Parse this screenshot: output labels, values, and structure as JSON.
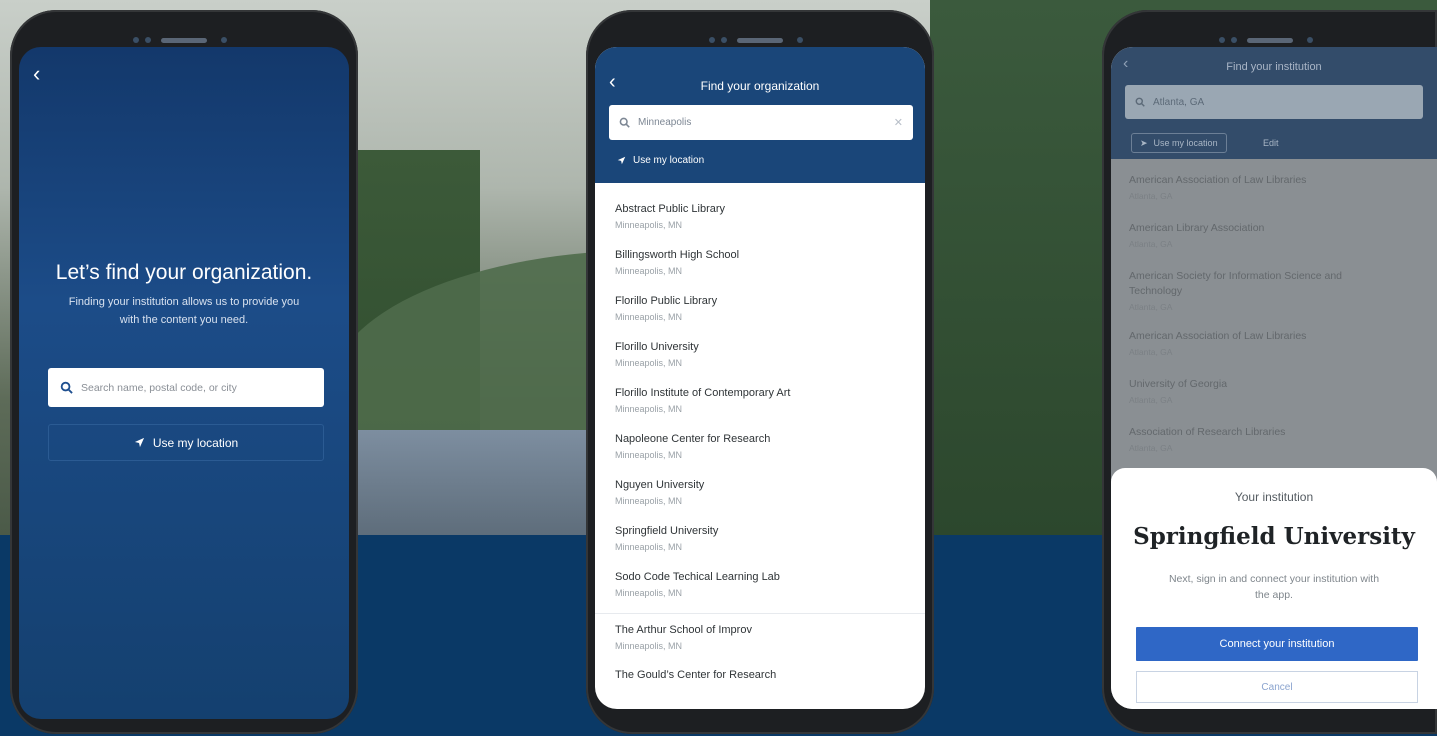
{
  "screen1": {
    "back_icon": "chevron-left-icon",
    "heading": "Let’s find your organization.",
    "subtitle": "Finding your institution allows us to provide you with the content you need.",
    "search_placeholder": "Search name, postal code, or city",
    "location_label": "Use my location"
  },
  "screen2": {
    "title": "Find your organization",
    "search_value": "Minneapolis",
    "location_label": "Use my location",
    "results": [
      {
        "name": "Abstract Public Library",
        "loc": "Minneapolis, MN"
      },
      {
        "name": "Billingsworth High School",
        "loc": "Minneapolis, MN"
      },
      {
        "name": "Florillo Public Library",
        "loc": "Minneapolis, MN"
      },
      {
        "name": "Florillo University",
        "loc": "Minneapolis, MN"
      },
      {
        "name": "Florillo Institute of Contemporary Art",
        "loc": "Minneapolis, MN"
      },
      {
        "name": "Napoleone Center for Research",
        "loc": "Minneapolis, MN"
      },
      {
        "name": "Nguyen University",
        "loc": "Minneapolis, MN"
      },
      {
        "name": "Springfield University",
        "loc": "Minneapolis, MN"
      },
      {
        "name": "Sodo Code Techical Learning Lab",
        "loc": "Minneapolis, MN"
      },
      {
        "name": "The Arthur School of Improv",
        "loc": "Minneapolis, MN"
      },
      {
        "name": "The Gould’s Center for Research",
        "loc": ""
      }
    ]
  },
  "screen3": {
    "title": "Find your institution",
    "search_value": "Atlanta, GA",
    "chip_location": "Use my location",
    "chip_other": "Edit",
    "results": [
      {
        "name": "American Association of Law Libraries",
        "loc": "Atlanta, GA"
      },
      {
        "name": "American Library Association",
        "loc": "Atlanta, GA"
      },
      {
        "name": "American Society for Information Science and Technology",
        "loc": "Atlanta, GA"
      },
      {
        "name": "American Association of Law Libraries",
        "loc": "Atlanta, GA"
      },
      {
        "name": "University of Georgia",
        "loc": "Atlanta, GA"
      },
      {
        "name": "Association of Research Libraries",
        "loc": "Atlanta, GA"
      }
    ],
    "sheet_title": "Your institution",
    "institution_name": "Springfield University",
    "next_text": "Next, sign in and connect your institution with the app.",
    "connect_label": "Connect your institution",
    "cancel_label": "Cancel"
  }
}
